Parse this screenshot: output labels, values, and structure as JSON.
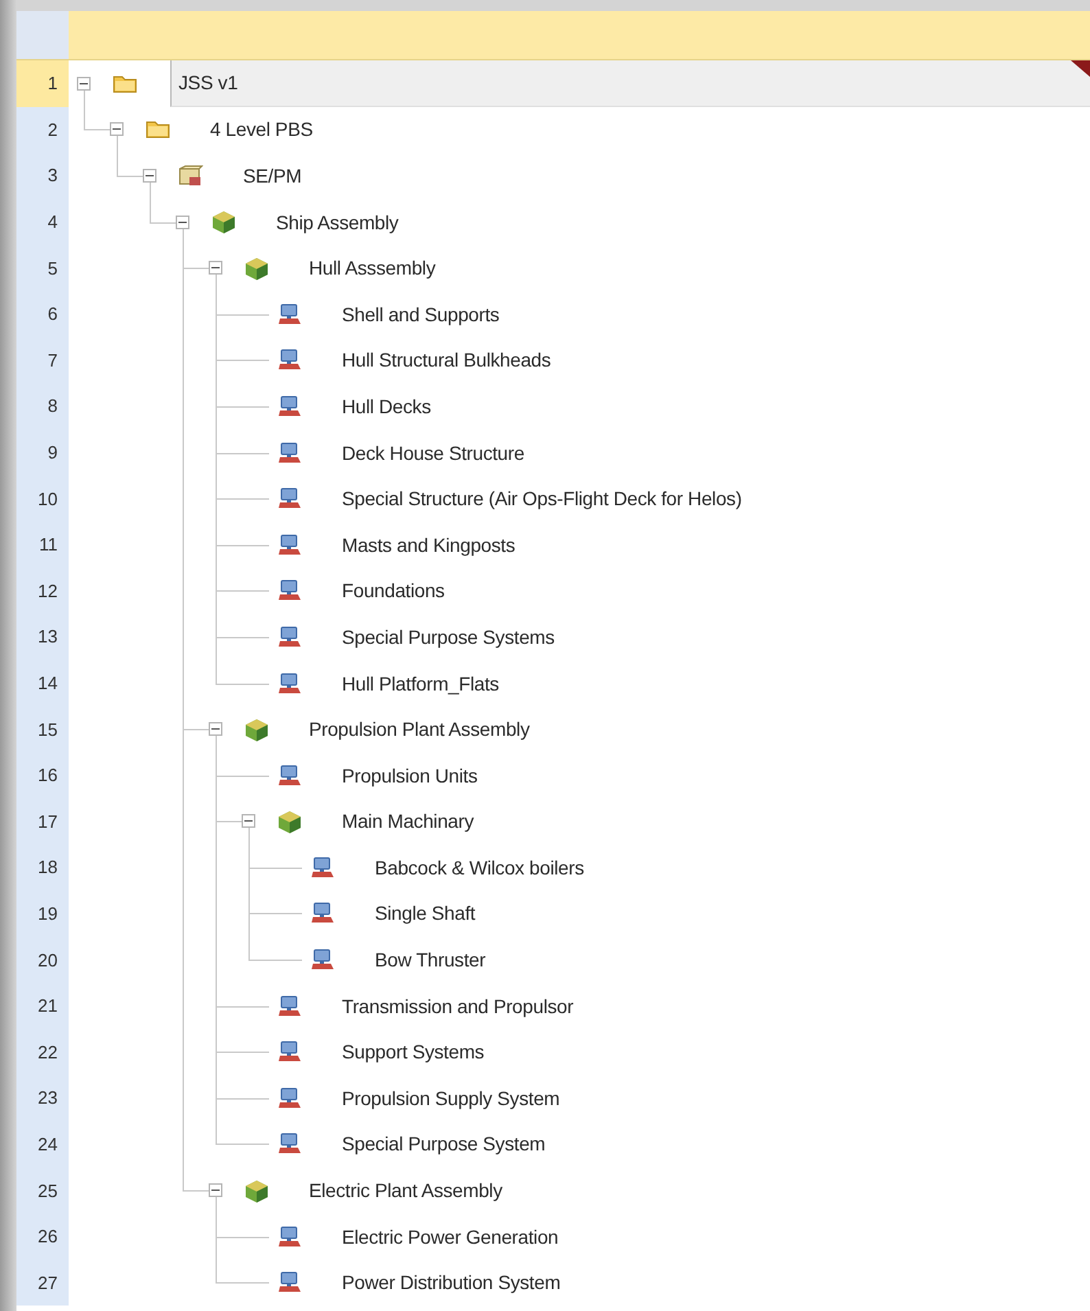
{
  "tree": [
    {
      "number": "1",
      "label": "JSS v1",
      "kind": "folder",
      "expanded": true,
      "selected": true,
      "children": [
        {
          "number": "2",
          "label": "4 Level PBS",
          "kind": "folder",
          "expanded": true,
          "selected": false,
          "children": [
            {
              "number": "3",
              "label": "SE/PM",
              "kind": "package",
              "expanded": true,
              "selected": false,
              "children": [
                {
                  "number": "4",
                  "label": "Ship Assembly",
                  "kind": "assembly",
                  "expanded": true,
                  "selected": false,
                  "children": [
                    {
                      "number": "5",
                      "label": "Hull Asssembly",
                      "kind": "assembly",
                      "expanded": true,
                      "selected": false,
                      "children": [
                        {
                          "number": "6",
                          "label": "Shell and Supports",
                          "kind": "part",
                          "selected": false
                        },
                        {
                          "number": "7",
                          "label": "Hull Structural Bulkheads",
                          "kind": "part",
                          "selected": false
                        },
                        {
                          "number": "8",
                          "label": "Hull Decks",
                          "kind": "part",
                          "selected": false
                        },
                        {
                          "number": "9",
                          "label": "Deck House Structure",
                          "kind": "part",
                          "selected": false
                        },
                        {
                          "number": "10",
                          "label": "Special Structure (Air Ops-Flight Deck for Helos)",
                          "kind": "part",
                          "selected": false
                        },
                        {
                          "number": "11",
                          "label": "Masts and Kingposts",
                          "kind": "part",
                          "selected": false
                        },
                        {
                          "number": "12",
                          "label": "Foundations",
                          "kind": "part",
                          "selected": false
                        },
                        {
                          "number": "13",
                          "label": "Special Purpose Systems",
                          "kind": "part",
                          "selected": false
                        },
                        {
                          "number": "14",
                          "label": "Hull Platform_Flats",
                          "kind": "part",
                          "selected": false
                        }
                      ]
                    },
                    {
                      "number": "15",
                      "label": "Propulsion Plant Assembly",
                      "kind": "assembly",
                      "expanded": true,
                      "selected": false,
                      "children": [
                        {
                          "number": "16",
                          "label": "Propulsion Units",
                          "kind": "part",
                          "selected": false
                        },
                        {
                          "number": "17",
                          "label": "Main Machinary",
                          "kind": "assembly",
                          "expanded": true,
                          "selected": false,
                          "children": [
                            {
                              "number": "18",
                              "label": "Babcock & Wilcox boilers",
                              "kind": "part",
                              "selected": false
                            },
                            {
                              "number": "19",
                              "label": "Single Shaft",
                              "kind": "part",
                              "selected": false
                            },
                            {
                              "number": "20",
                              "label": "Bow Thruster",
                              "kind": "part",
                              "selected": false
                            }
                          ]
                        },
                        {
                          "number": "21",
                          "label": "Transmission and Propulsor",
                          "kind": "part",
                          "selected": false
                        },
                        {
                          "number": "22",
                          "label": "Support Systems",
                          "kind": "part",
                          "selected": false
                        },
                        {
                          "number": "23",
                          "label": "Propulsion Supply System",
                          "kind": "part",
                          "selected": false
                        },
                        {
                          "number": "24",
                          "label": "Special Purpose System",
                          "kind": "part",
                          "selected": false
                        }
                      ]
                    },
                    {
                      "number": "25",
                      "label": "Electric Plant Assembly",
                      "kind": "assembly",
                      "expanded": true,
                      "selected": false,
                      "children": [
                        {
                          "number": "26",
                          "label": "Electric Power Generation",
                          "kind": "part",
                          "selected": false
                        },
                        {
                          "number": "27",
                          "label": "Power Distribution System",
                          "kind": "part",
                          "selected": false
                        }
                      ]
                    }
                  ]
                }
              ]
            }
          ]
        }
      ]
    }
  ]
}
